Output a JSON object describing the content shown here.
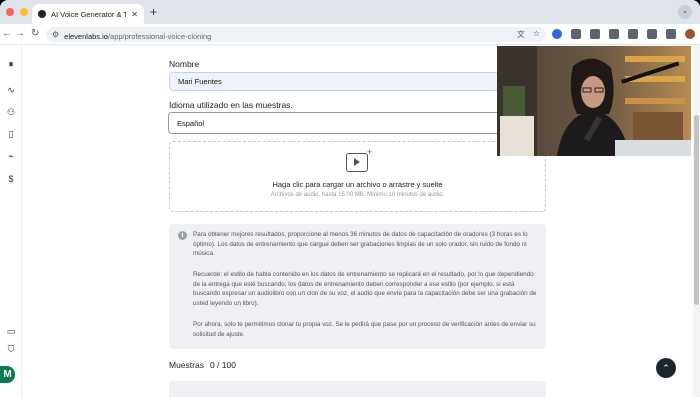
{
  "browser": {
    "tab_title": "AI Voice Generator & Text to S",
    "tab_close": "✕",
    "new_tab": "+",
    "tab_menu": "⌄",
    "url_host": "elevenlabs.io",
    "url_path": "/app/professional-voice-cloning",
    "nav_back": "←",
    "nav_forward": "→",
    "nav_reload": "↻",
    "translate_glyph": "文",
    "star_glyph": "☆",
    "menu_glyph": "⋮",
    "dot_colors": [
      "#ff5f57",
      "#febc2e",
      "#28c840"
    ]
  },
  "sidebar": {
    "icons": [
      "pause-icon",
      "waveform-icon",
      "people-icon",
      "book-icon",
      "antenna-icon",
      "dollar-icon",
      "document-icon",
      "shield-icon"
    ],
    "glyphs": [
      "⏸",
      "∿",
      "⚇",
      "▯",
      "⌁",
      "$",
      "▭",
      "⛉"
    ],
    "avatar_initial": "M"
  },
  "form": {
    "name_label": "Nombre",
    "name_value": "Mari Fuentes",
    "language_label": "Idioma utilizado en las muestras.",
    "language_value": "Español",
    "upload_title": "Haga clic para cargar un archivo o arrastre y suelte",
    "upload_subtitle": "Archivos de audio, hasta 15.00 MB. Mínimo 10 minutos de audio.",
    "upload_plus": "+"
  },
  "info": {
    "icon": "i",
    "p1": "Para obtener mejores resultados, proporcione al menos 36 minutos de datos de capacitación de oradores (3 horas es lo óptimo). Los datos de entrenamiento que cargue deben ser grabaciones limpias de un solo orador, sin ruido de fondo ni música.",
    "p2": "Recuerde: el estilo de habla contenido en los datos de entrenamiento se replicará en el resultado, por lo que dependiendo de la entrega que esté buscando, los datos de entrenamiento deben corresponder a ese estilo (por ejemplo, si está buscando expresar un audiolibro con un clon de su voz, el audio que envíe para la capacitación debe ser una grabación de usted leyendo un libro).",
    "p3": "Por ahora, solo te permitimos clonar tu propia voz. Se le pedirá que pase por un proceso de verificación antes de enviar su solicitud de ajuste."
  },
  "samples": {
    "label": "Muestras",
    "count": "0 / 100"
  },
  "scroll_top_glyph": "⌃"
}
